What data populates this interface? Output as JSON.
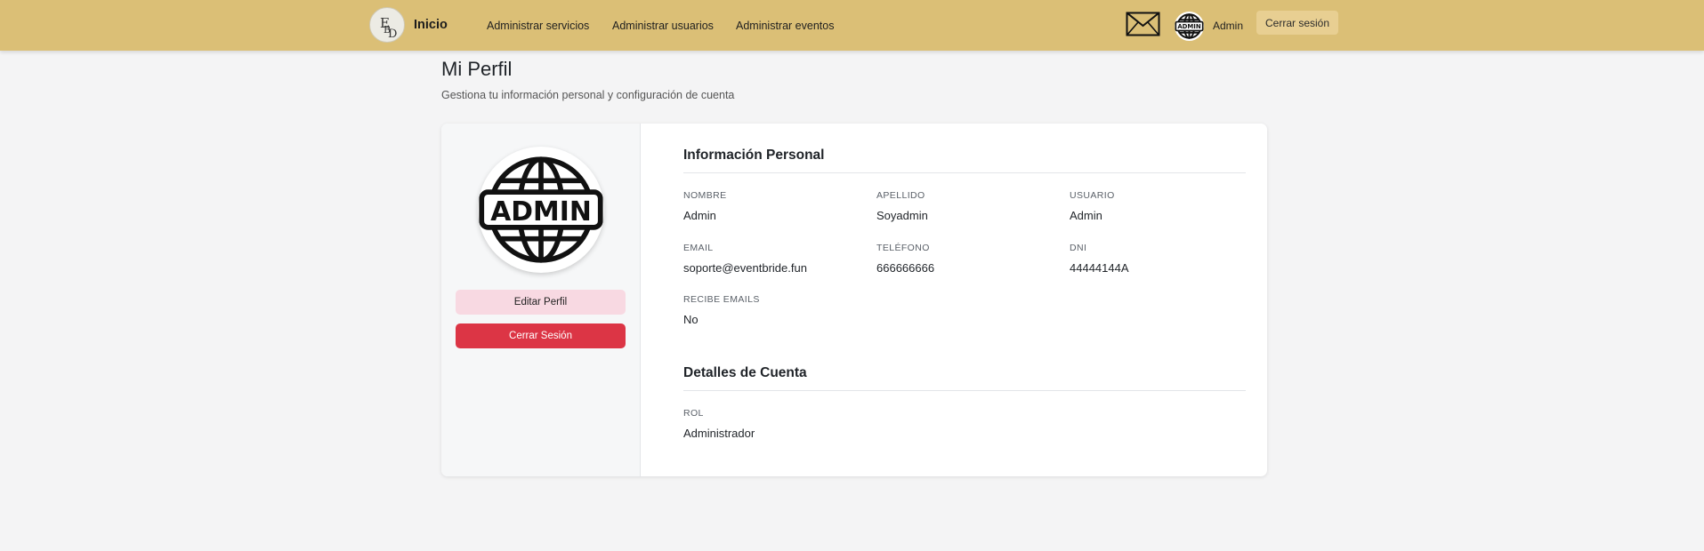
{
  "navbar": {
    "logo_text": "EBD",
    "brand": "Inicio",
    "links": [
      "Administrar servicios",
      "Administrar usuarios",
      "Administrar eventos"
    ],
    "mail_icon": "envelope-icon",
    "avatar_text": "ADMIN",
    "user_name": "Admin",
    "logout_label": "Cerrar sesión",
    "background_color": "#dbbf76"
  },
  "header": {
    "title": "Mi Perfil",
    "subtitle": "Gestiona tu información personal y configuración de cuenta"
  },
  "profile": {
    "avatar_text": "ADMIN",
    "edit_label": "Editar Perfil",
    "logout_label": "Cerrar Sesión"
  },
  "personal": {
    "title": "Información Personal",
    "fields": [
      {
        "label": "Nombre",
        "value": "Admin"
      },
      {
        "label": "Apellido",
        "value": "Soyadmin"
      },
      {
        "label": "Usuario",
        "value": "Admin"
      },
      {
        "label": "Email",
        "value": "soporte@eventbride.fun"
      },
      {
        "label": "Teléfono",
        "value": "666666666"
      },
      {
        "label": "DNI",
        "value": "44444144A"
      },
      {
        "label": "Recibe Emails",
        "value": "No"
      }
    ]
  },
  "account": {
    "title": "Detalles de Cuenta",
    "fields": [
      {
        "label": "Rol",
        "value": "Administrador"
      }
    ]
  },
  "colors": {
    "navbar": "#dbbf76",
    "danger": "#dc3545",
    "edit_button": "#f8d9e2"
  }
}
